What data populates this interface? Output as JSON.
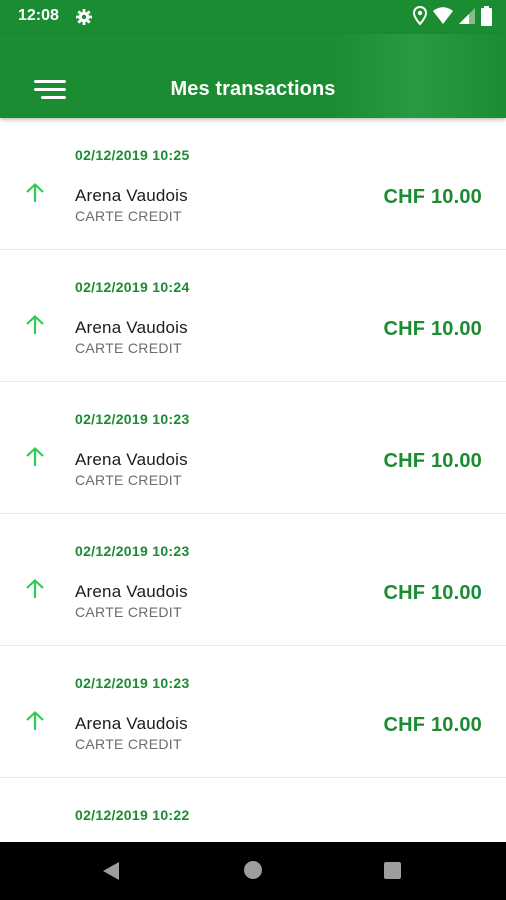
{
  "status_bar": {
    "time": "12:08",
    "icons": [
      "gear-icon",
      "location-icon",
      "wifi-icon",
      "signal-icon",
      "battery-icon"
    ]
  },
  "app_bar": {
    "title": "Mes transactions",
    "menu_icon": "menu-icon",
    "color": "#1b8c31"
  },
  "transactions": [
    {
      "date": "02/12/2019 10:25",
      "merchant": "Arena Vaudois",
      "method": "CARTE CREDIT",
      "amount": "CHF 10.00",
      "direction_icon": "arrow-up-icon"
    },
    {
      "date": "02/12/2019 10:24",
      "merchant": "Arena Vaudois",
      "method": "CARTE CREDIT",
      "amount": "CHF 10.00",
      "direction_icon": "arrow-up-icon"
    },
    {
      "date": "02/12/2019 10:23",
      "merchant": "Arena Vaudois",
      "method": "CARTE CREDIT",
      "amount": "CHF 10.00",
      "direction_icon": "arrow-up-icon"
    },
    {
      "date": "02/12/2019 10:23",
      "merchant": "Arena Vaudois",
      "method": "CARTE CREDIT",
      "amount": "CHF 10.00",
      "direction_icon": "arrow-up-icon"
    },
    {
      "date": "02/12/2019 10:23",
      "merchant": "Arena Vaudois",
      "method": "CARTE CREDIT",
      "amount": "CHF 10.00",
      "direction_icon": "arrow-up-icon"
    },
    {
      "date": "02/12/2019 10:22",
      "merchant": "",
      "method": "",
      "amount": "",
      "direction_icon": ""
    }
  ],
  "colors": {
    "accent": "#1b8c31",
    "arrow": "#2ecc55",
    "merchant_text": "#1c1c1c",
    "method_text": "#6b6b6b"
  },
  "nav_bar": {
    "icons": [
      "back-icon",
      "home-icon",
      "recents-icon"
    ]
  }
}
